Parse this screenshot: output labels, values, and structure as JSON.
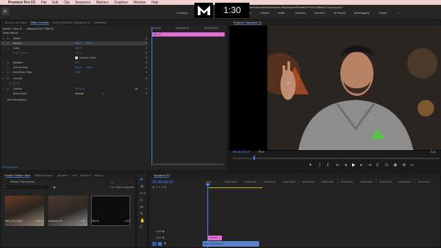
{
  "mac_menu": {
    "apple": "",
    "app": "Premiere Pro CC",
    "items": [
      "File",
      "Edit",
      "Clip",
      "Sequence",
      "Markers",
      "Graphics",
      "Window",
      "Help"
    ]
  },
  "header": {
    "path": "/Volumes/Documents/Daniel's Mac/Adobe/Premiere Pro/9.0/Motion Track.prproj *",
    "workspaces": [
      "Learning",
      "Assembly",
      "Editing",
      "Color",
      "Effects",
      "Audio",
      "Graphics",
      "Libraries",
      "All Panels",
      "Metalogging",
      "Daniel"
    ],
    "timer": "1:30"
  },
  "effect_controls": {
    "tabs": [
      "Source: (no clips)",
      "Effect Controls",
      "Audio Clip Mixer: Sequence 01",
      "Metadata"
    ],
    "breadcrumb_master": "Master * Title 01",
    "breadcrumb_seq": "Sequence 01 * Title 01",
    "section_video": "Video Effects",
    "motion": "Motion",
    "position": "Position",
    "position_x": "960.0",
    "position_y": "540.0",
    "scale": "Scale",
    "scale_val": "100.0",
    "scale_width": "Scale Width",
    "scale_width_val": "100.0",
    "uniform_scale": "Uniform Scale",
    "rotation": "Rotation",
    "rotation_val": "0.0",
    "anchor": "Anchor Point",
    "anchor_x": "960.0",
    "anchor_y": "540.0",
    "antiflicker": "Anti-flicker Filter",
    "antiflicker_val": "0.00",
    "opacity_section": "Opacity",
    "opacity": "Opacity",
    "opacity_val": "100.0 %",
    "blend": "Blend Mode",
    "blend_val": "Normal",
    "time_remap": "Time Remapping",
    "ruler": [
      "00:00:00",
      "00:00:09:23",
      "00:00:14:23"
    ],
    "clip_label": "Title 01",
    "timecode": "00:00:04:19"
  },
  "program": {
    "tab": "Program: Sequence 01",
    "timecode_left": "00:00:04:19",
    "fit": "Fit",
    "full": "Full",
    "timecode_right": "00:00:09:23"
  },
  "project": {
    "tabs": [
      "Project: Motion Track",
      "Media Browser",
      "Libraries",
      "Info",
      "Markers",
      "History"
    ],
    "project_file": "Motion Track.prproj",
    "items_selected": "1 of 3 items selected",
    "items": [
      {
        "name": "DMC_8761.MOV",
        "duration": "2:46:22"
      },
      {
        "name": "Sequence 01",
        "duration": "9:23"
      },
      {
        "name": "Title 01",
        "duration": "4:23"
      }
    ]
  },
  "timeline": {
    "tab": "Sequence 01",
    "timecode": "00:00:04:19",
    "ruler": [
      "00:00",
      "00:00:04:23",
      "00:00:09:23",
      "00:00:14:23",
      "00:00:19:23",
      "00:00:24:23",
      "00:00:29:23",
      "00:00:34:23",
      "00:00:39:23",
      "00:00:44:23",
      "00:00:49:23",
      "00:00:54:23"
    ],
    "tracks": [
      "V3",
      "V2",
      "V1"
    ],
    "title_clip": "Title 01",
    "video_clip": "DMC_8761.MOV [V]"
  },
  "colors": {
    "accent_blue": "#3d8cff",
    "title_clip_pink": "#e36fd6",
    "video_clip_blue": "#5b83c9",
    "menubar": "#f3d3d2"
  }
}
